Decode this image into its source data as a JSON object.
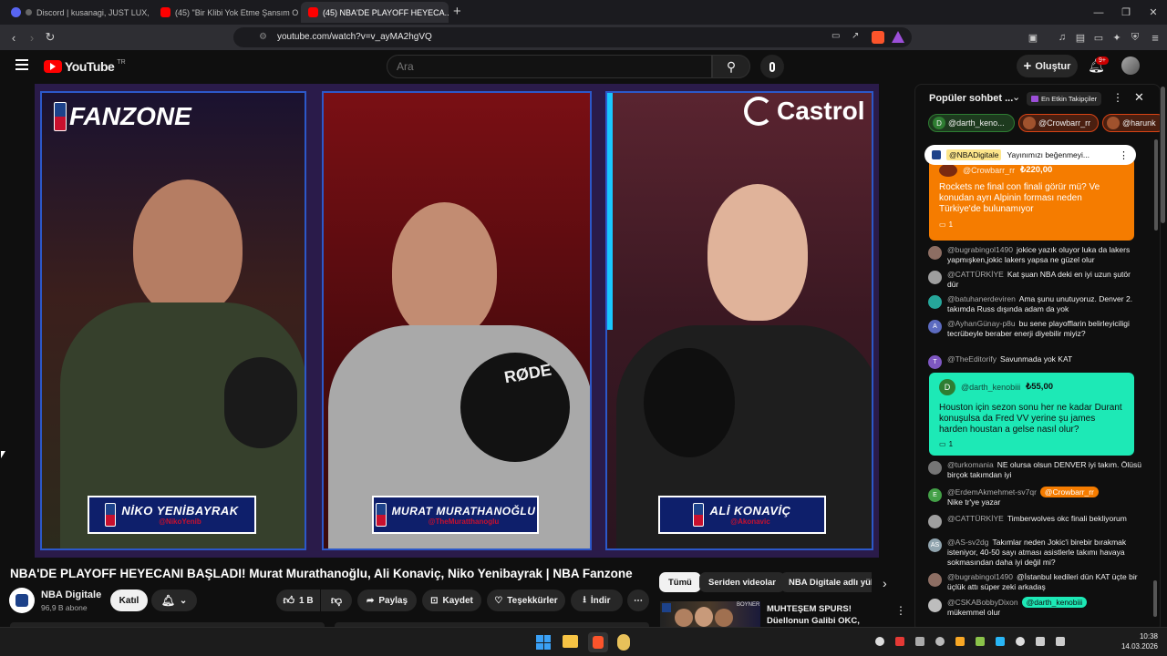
{
  "browser": {
    "tabs": [
      {
        "label": "Discord | kusanagi, JUST LUX, \"Y...",
        "color": "#5865f2"
      },
      {
        "label": "(45) \"Bir Klibi Yok Etme Şansım O...",
        "color": "#ff0000"
      },
      {
        "label": "(45) NBA'DE PLAYOFF HEYECA...",
        "color": "#ff0000"
      }
    ],
    "url": "youtube.com/watch?v=v_ayMA2hgVQ",
    "new_tab": "+"
  },
  "youtube": {
    "logo_text": "YouTube",
    "logo_sup": "TR",
    "search_placeholder": "Ara",
    "create_label": "Oluştur",
    "notification_badge": "9+"
  },
  "video": {
    "top_left_logo": "FANZONE",
    "top_right_logo": "Castrol",
    "panels": [
      {
        "name": "NİKO YENİBAYRAK",
        "handle": "@NikoYenib",
        "bg": "#3b1f1c"
      },
      {
        "name": "MURAT MURATHANOĞLU",
        "handle": "@TheMuratthanoglu",
        "bg": "#6b0d10"
      },
      {
        "name": "ALİ KONAVİÇ",
        "handle": "@Akonavic",
        "bg": "#4a1a22"
      }
    ],
    "mic_brand": "RØDE"
  },
  "info": {
    "title": "NBA'DE PLAYOFF HEYECANI BAŞLADI! Murat Murathanoğlu, Ali Konaviç, Niko Yenibayrak | NBA Fanzone",
    "channel": "NBA Digitale",
    "subscribers": "96,9 B abone",
    "join": "Katıl",
    "likes": "1 B",
    "share": "Paylaş",
    "save": "Kaydet",
    "thanks": "Teşekkürler",
    "download": "İndir",
    "filters": [
      "Tümü",
      "Seriden videolar",
      "NBA Digitale adlı yük"
    ],
    "rec_title": "MUHTEŞEM SPURS! Düellonun Galibi OKC, Alperen & Rockets ...",
    "rec_thumb_label": "BOYNER"
  },
  "chat": {
    "header_title": "Popüler sohbet ...",
    "top_badge": "En Etkin Takipçiler",
    "chips": [
      {
        "initial": "D",
        "name": "@darth_keno...",
        "color": "#2e7d32"
      },
      {
        "initial": "",
        "name": "@Crowbarr_rr",
        "color": "#d84315"
      },
      {
        "initial": "",
        "name": "@harunk",
        "color": "#d84315"
      }
    ],
    "pinned": {
      "author": "@NBADigitale",
      "text": "Yayınımızı beğenmeyi..."
    },
    "superchat1": {
      "author": "@Crowbarr_rr",
      "amount": "₺220,00",
      "text": "Rockets ne final con finali görür mü? Ve konudan ayrı Alpinin forması neden Türkiye'de bulunamıyor",
      "replies": "1",
      "color": "#f57c00"
    },
    "superchat2": {
      "initial": "D",
      "author": "@darth_kenobiii",
      "amount": "₺55,00",
      "text": "Houston için sezon sonu her ne kadar Durant konuşulsa da Fred VV yerine şu james harden houstan a gelse nasıl olur?",
      "replies": "1",
      "color": "#1de9b6"
    },
    "messages_a": [
      {
        "author": "@bugrabingol1490",
        "text": "jokice yazık oluyor luka da lakers yapmışken,jokic lakers yapsa ne güzel olur",
        "color": "#8d6e63",
        "initial": ""
      },
      {
        "author": "@CATTÜRKİYE",
        "text": "Kat şuan NBA deki en iyi uzun şutör dür",
        "color": "#9e9e9e",
        "initial": ""
      },
      {
        "author": "@batuhanerdeviren",
        "text": "Ama şunu unutuyoruz. Denver 2. takımda Russ dışında adam da yok",
        "color": "#26a69a",
        "initial": ""
      },
      {
        "author": "@AyhanGünay-p8u",
        "text": "bu sene playofflarin belirleyiciligi tecrübeyle beraber enerji diyebilir miyiz?",
        "color": "#5c6bc0",
        "initial": "A"
      },
      {
        "author": "@TheEditorify",
        "text": "Savunmada yok KAT",
        "color": "#7e57c2",
        "initial": "T"
      }
    ],
    "messages_b": [
      {
        "author": "@turkomania",
        "text": "NE olursa olsun DENVER iyi takım. Ölüsü birçok takımdan iyi",
        "color": "#757575",
        "initial": ""
      },
      {
        "author": "@ErdemAkmehmet-sv7qr",
        "text": "Nike tr'ye yazar",
        "color": "#43a047",
        "initial": "E",
        "mention": "@Crowbarr_rr"
      },
      {
        "author": "@CATTÜRKİYE",
        "text": "Timberwolves okc finali bekliyorum",
        "color": "#9e9e9e",
        "initial": ""
      },
      {
        "author": "@AS-sv2dg",
        "text": "Takımlar neden Jokic'i birebir bırakmak isteniyor, 40-50 sayı atması asistlerle takımı havaya sokmasından daha iyi değil mi?",
        "color": "#90a4ae",
        "initial": "AS"
      },
      {
        "author": "@bugrabingol1490",
        "text": "@İstanbul kedileri dün KAT üçte bir üçlük attı süper zeki arkadaş",
        "color": "#8d6e63",
        "initial": ""
      },
      {
        "author": "@CSKABobbyDixon",
        "text": "mükemmel olur",
        "color": "#bdbdbd",
        "initial": "",
        "mention": "@darth_kenobiii"
      }
    ]
  },
  "taskbar": {
    "time": "10:38",
    "date": "14.03.2026"
  }
}
